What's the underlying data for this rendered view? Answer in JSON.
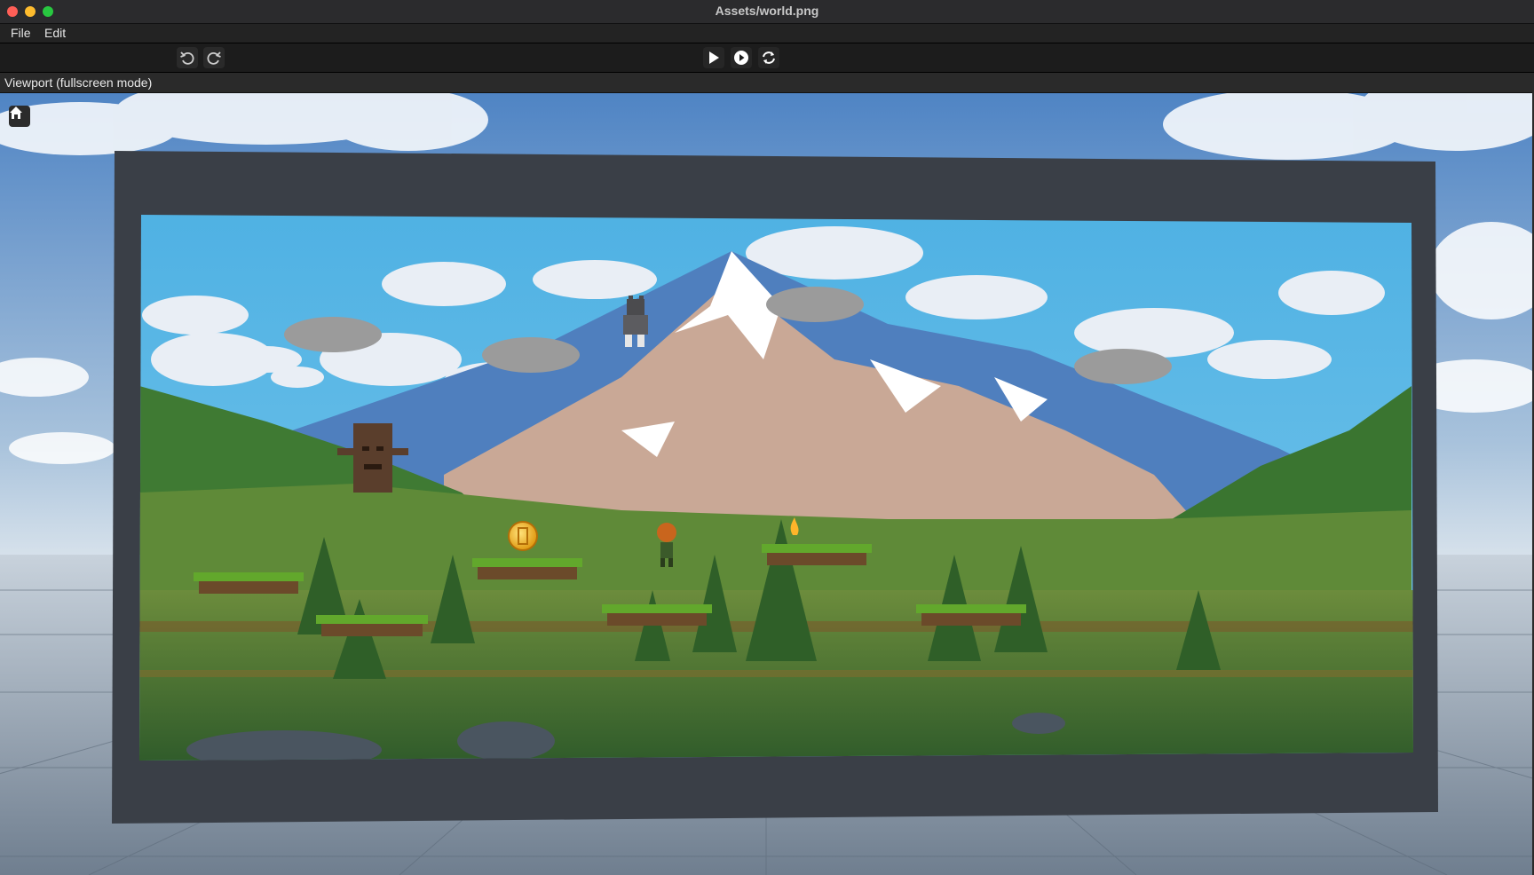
{
  "window": {
    "title": "Assets/world.png"
  },
  "menu": {
    "file": "File",
    "edit": "Edit"
  },
  "toolbar": {
    "undo_icon": "undo-icon",
    "redo_icon": "redo-icon",
    "play_icon": "play-icon",
    "play_step_icon": "play-circle-icon",
    "reload_icon": "reload-icon"
  },
  "viewport": {
    "title": "Viewport (fullscreen mode)",
    "home_icon": "home-icon"
  },
  "colors": {
    "sky_top": "#5c8fc9",
    "game_sky": "#5bb8e6",
    "frame": "#3a3f47",
    "grass": "#5f9f2c",
    "coin": "#f4b321"
  }
}
